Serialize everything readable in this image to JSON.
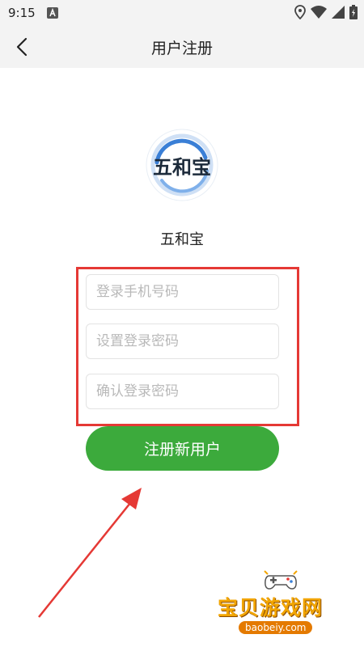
{
  "status_bar": {
    "time": "9:15"
  },
  "app_bar": {
    "title": "用户注册"
  },
  "logo": {
    "text": "五和宝"
  },
  "app_name": "五和宝",
  "form": {
    "phone_placeholder": "登录手机号码",
    "password_placeholder": "设置登录密码",
    "confirm_placeholder": "确认登录密码"
  },
  "register_button": "注册新用户",
  "watermark": {
    "text": "宝贝游戏网",
    "url": "baobeiy.com"
  },
  "colors": {
    "accent_green": "#3caa3c",
    "highlight_red": "#e53935"
  }
}
